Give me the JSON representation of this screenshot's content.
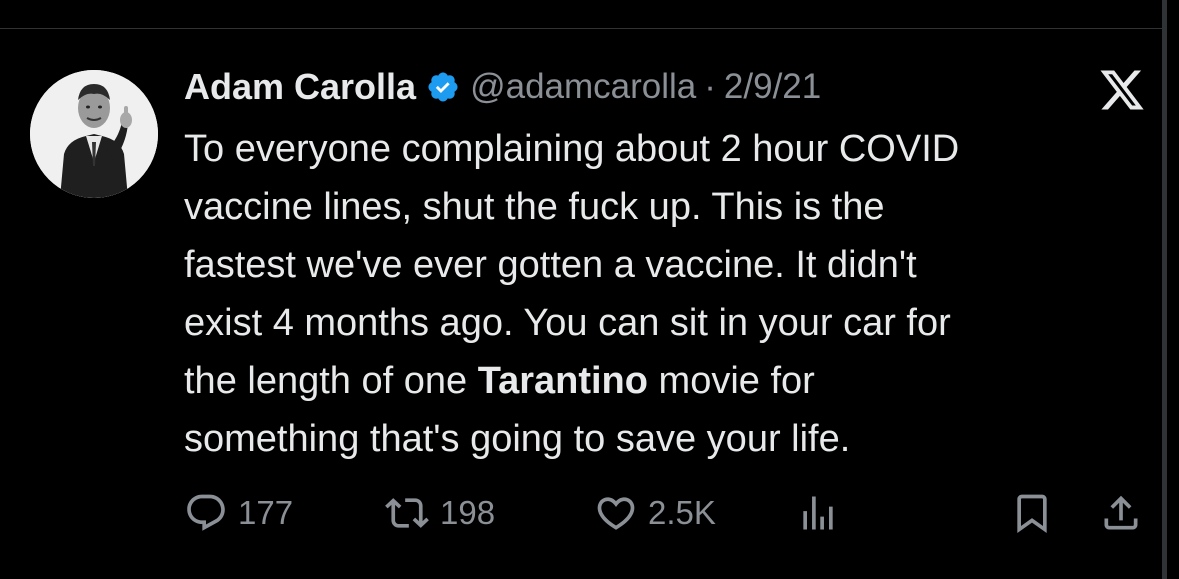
{
  "tweet": {
    "author": {
      "display_name": "Adam Carolla",
      "handle": "@adamcarolla",
      "verified": true
    },
    "separator": "·",
    "date": "2/9/21",
    "text_lines": [
      "To everyone complaining about 2 hour COVID",
      "vaccine lines, shut the fuck up.  This is the",
      "fastest we've ever gotten a vaccine.  It didn't",
      "exist 4 months ago. You can sit in your car for"
    ],
    "line5_before": "the length of one ",
    "line5_bold": "Tarantino",
    "line5_after": " movie for",
    "line6": "something that's going to save your life.",
    "stats": {
      "replies": "177",
      "retweets": "198",
      "likes": "2.5K"
    }
  },
  "icons": {
    "verified": "verified-badge-icon",
    "platform": "x-logo-icon",
    "reply": "reply-icon",
    "retweet": "retweet-icon",
    "like": "heart-icon",
    "views": "views-icon",
    "bookmark": "bookmark-icon",
    "share": "share-icon"
  },
  "colors": {
    "background": "#000000",
    "text": "#e7e9ea",
    "secondary": "#8b9096",
    "verified": "#1d9bf0",
    "divider": "#2f3336"
  }
}
